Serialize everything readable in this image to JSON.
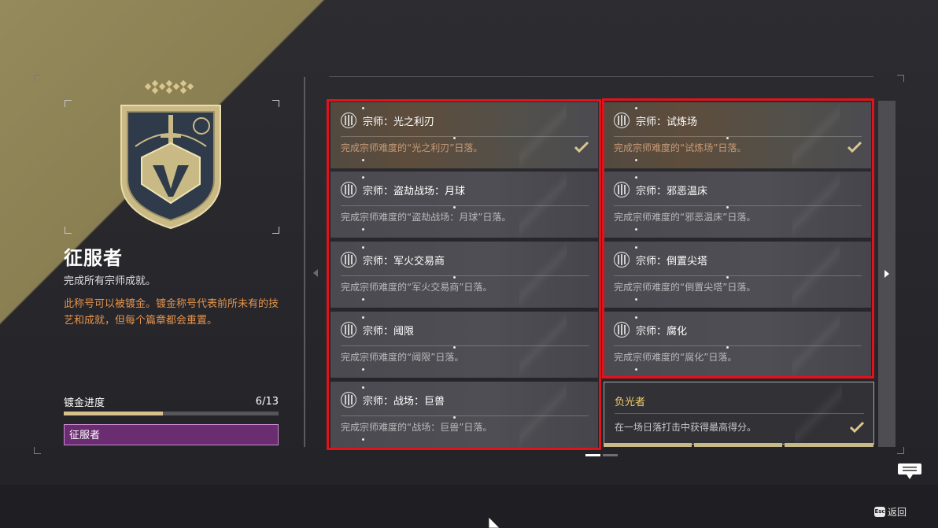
{
  "title": {
    "name": "征服者",
    "description": "完成所有宗师成就。",
    "gild_note": "此称号可以被镀金。镀金称号代表前所未有的技艺和成就，但每个篇章都会重置。"
  },
  "gilding": {
    "label": "镀金进度",
    "count_text": "6/13",
    "progress_fraction": 0.462,
    "title_chip": "征服者"
  },
  "triumphs": [
    {
      "title": "宗师：光之利刃",
      "desc": "完成宗师难度的“光之利刃”日落。",
      "completed": true
    },
    {
      "title": "宗师：试炼场",
      "desc": "完成宗师难度的“试炼场”日落。",
      "completed": true
    },
    {
      "title": "宗师：盗劫战场：月球",
      "desc": "完成宗师难度的“盗劫战场：月球”日落。",
      "completed": false
    },
    {
      "title": "宗师：邪恶温床",
      "desc": "完成宗师难度的“邪恶温床”日落。",
      "completed": false
    },
    {
      "title": "宗师：军火交易商",
      "desc": "完成宗师难度的“军火交易商”日落。",
      "completed": false
    },
    {
      "title": "宗师：倒置尖塔",
      "desc": "完成宗师难度的“倒置尖塔”日落。",
      "completed": false
    },
    {
      "title": "宗师：阈限",
      "desc": "完成宗师难度的“阈限”日落。",
      "completed": false
    },
    {
      "title": "宗师：腐化",
      "desc": "完成宗师难度的“腐化”日落。",
      "completed": false
    },
    {
      "title": "宗师：战场：巨兽",
      "desc": "完成宗师难度的“战场：巨兽”日落。",
      "completed": false
    },
    {
      "title": "负光者",
      "desc": "在一场日落打击中获得最高得分。",
      "completed": true
    }
  ],
  "footer": {
    "back_label": "返回",
    "esc_key": "Esc"
  },
  "colors": {
    "highlight_border": "#e2121b",
    "gild_text": "#e5944c",
    "title_chip_bg": "#6b2d71",
    "progress_fill": "#d8c08c"
  }
}
